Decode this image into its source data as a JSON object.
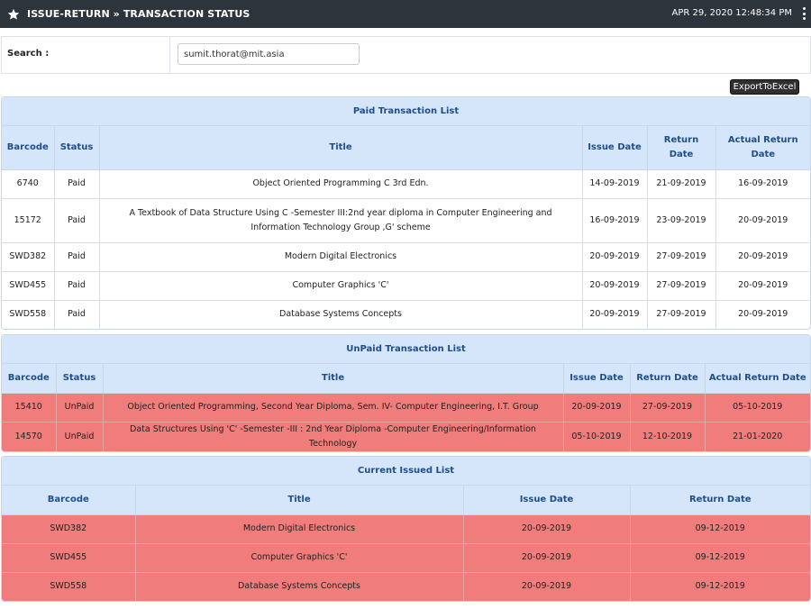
{
  "header": {
    "title": "ISSUE-RETURN » TRANSACTION STATUS",
    "datetime": "APR 29, 2020   12:48:34 PM"
  },
  "search": {
    "label": "Search :",
    "value": "sumit.thorat@mit.asia"
  },
  "export_label": "ExportToExcel",
  "paid": {
    "title": "Paid Transaction List",
    "columns": [
      "Barcode",
      "Status",
      "Title",
      "Issue Date",
      "Return Date",
      "Actual Return Date"
    ],
    "rows": [
      [
        "6740",
        "Paid",
        "Object Oriented Programming C 3rd Edn.",
        "14-09-2019",
        "21-09-2019",
        "16-09-2019"
      ],
      [
        "15172",
        "Paid",
        "A Textbook of Data Structure Using C -Semester III:2nd year diploma in Computer Engineering and Information Technology Group ,G' scheme",
        "16-09-2019",
        "23-09-2019",
        "20-09-2019"
      ],
      [
        "SWD382",
        "Paid",
        "Modern Digital Electronics",
        "20-09-2019",
        "27-09-2019",
        "20-09-2019"
      ],
      [
        "SWD455",
        "Paid",
        "Computer Graphics 'C'",
        "20-09-2019",
        "27-09-2019",
        "20-09-2019"
      ],
      [
        "SWD558",
        "Paid",
        "Database Systems Concepts",
        "20-09-2019",
        "27-09-2019",
        "20-09-2019"
      ]
    ]
  },
  "unpaid": {
    "title": "UnPaid Transaction List",
    "columns": [
      "Barcode",
      "Status",
      "Title",
      "Issue Date",
      "Return Date",
      "Actual Return Date"
    ],
    "rows": [
      [
        "15410",
        "UnPaid",
        "Object Oriented Programming, Second Year Diploma, Sem. IV- Computer Engineering, I.T. Group",
        "20-09-2019",
        "27-09-2019",
        "05-10-2019"
      ],
      [
        "14570",
        "UnPaid",
        "Data Structures Using 'C' -Semester -III : 2nd Year Diploma -Computer Engineering/Information Technology",
        "05-10-2019",
        "12-10-2019",
        "21-01-2020"
      ]
    ]
  },
  "issued": {
    "title": "Current Issued List",
    "columns": [
      "Barcode",
      "Title",
      "Issue Date",
      "Return Date"
    ],
    "rows": [
      [
        "SWD382",
        "Modern Digital Electronics",
        "20-09-2019",
        "09-12-2019"
      ],
      [
        "SWD455",
        "Computer Graphics 'C'",
        "20-09-2019",
        "09-12-2019"
      ],
      [
        "SWD558",
        "Database Systems Concepts",
        "20-09-2019",
        "09-12-2019"
      ]
    ]
  },
  "colors": {
    "topbar": "#2e343b",
    "header_bg": "#d6e6fa",
    "header_text": "#1e4e8a",
    "row_alert": "#f07c7c"
  }
}
